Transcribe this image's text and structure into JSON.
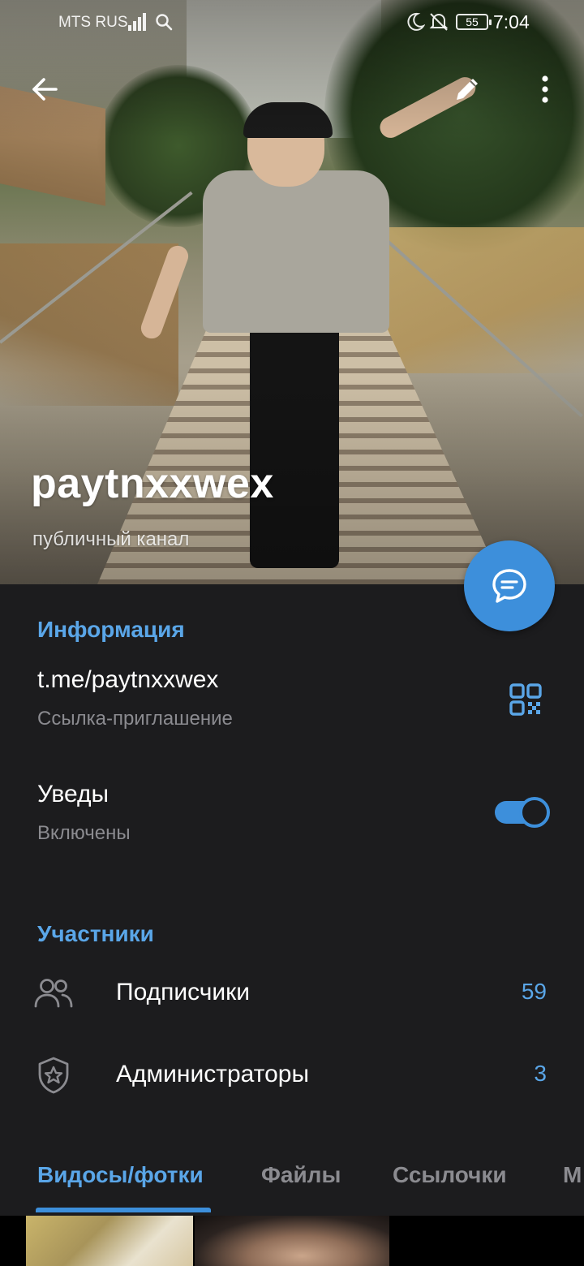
{
  "status_bar": {
    "carrier": "MTS RUS",
    "battery": "55",
    "time": "7:04"
  },
  "header": {
    "channel_name": "paytnxxwex",
    "channel_type": "публичный канал"
  },
  "info": {
    "section_title": "Информация",
    "link": "t.me/paytnxxwex",
    "link_caption": "Ссылка-приглашение",
    "notifications_title": "Уведы",
    "notifications_status": "Включены",
    "notifications_enabled": true
  },
  "members": {
    "section_title": "Участники",
    "subscribers_label": "Подписчики",
    "subscribers_count": "59",
    "admins_label": "Администраторы",
    "admins_count": "3"
  },
  "tabs": {
    "items": [
      "Видосы/фотки",
      "Файлы",
      "Ссылочки",
      "М"
    ],
    "active_index": 0
  },
  "icons": {
    "back": "arrow-left-icon",
    "edit": "pencil-icon",
    "more": "more-vertical-icon",
    "fab": "chat-bubble-icon",
    "qr": "qr-code-icon",
    "subscribers": "people-icon",
    "admins": "shield-star-icon"
  },
  "colors": {
    "accent": "#3d8fdb",
    "accent_text": "#5aa6e8",
    "background": "#1c1c1e",
    "secondary_text": "#8b8b90"
  }
}
